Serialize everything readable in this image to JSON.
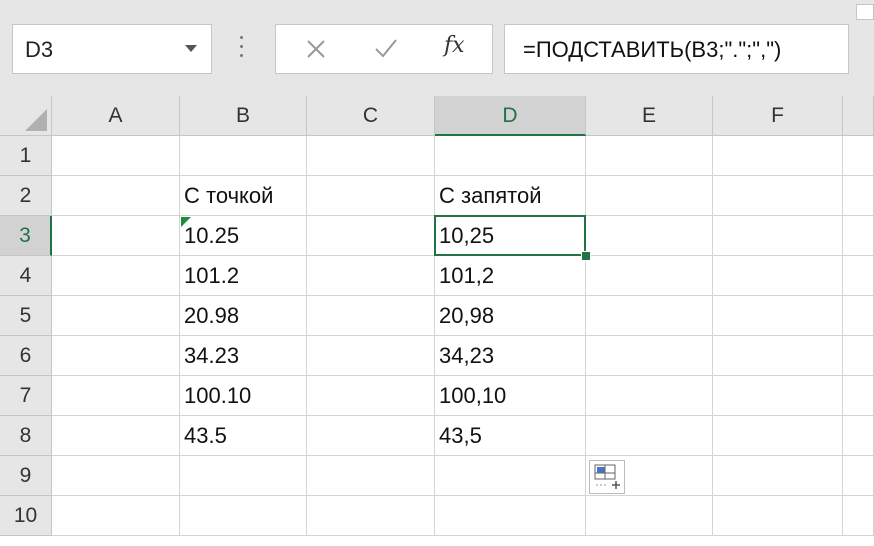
{
  "name_box": {
    "value": "D3"
  },
  "formula_bar": {
    "cancel_icon": "close-icon",
    "enter_icon": "check-icon",
    "fx_label": "fx",
    "formula": "=ПОДСТАВИТЬ(B3;\".\";\",\")"
  },
  "columns": [
    "A",
    "B",
    "C",
    "D",
    "E",
    "F"
  ],
  "rows": [
    "1",
    "2",
    "3",
    "4",
    "5",
    "6",
    "7",
    "8",
    "9",
    "10"
  ],
  "selected_cell": {
    "column": "D",
    "row": "3"
  },
  "cells": {
    "B2": "С точкой",
    "D2": "С запятой",
    "B3": "10.25",
    "D3": "10,25",
    "B4": "101.2",
    "D4": "101,2",
    "B5": "20.98",
    "D5": "20,98",
    "B6": "34.23",
    "D6": "34,23",
    "B7": "100.10",
    "D7": "100,10",
    "B8": "43.5",
    "D8": "43,5"
  },
  "colors": {
    "accent": "#217346",
    "error_indicator": "#1e8c3c"
  },
  "icons": {
    "paste_options": "paste-options-icon"
  }
}
